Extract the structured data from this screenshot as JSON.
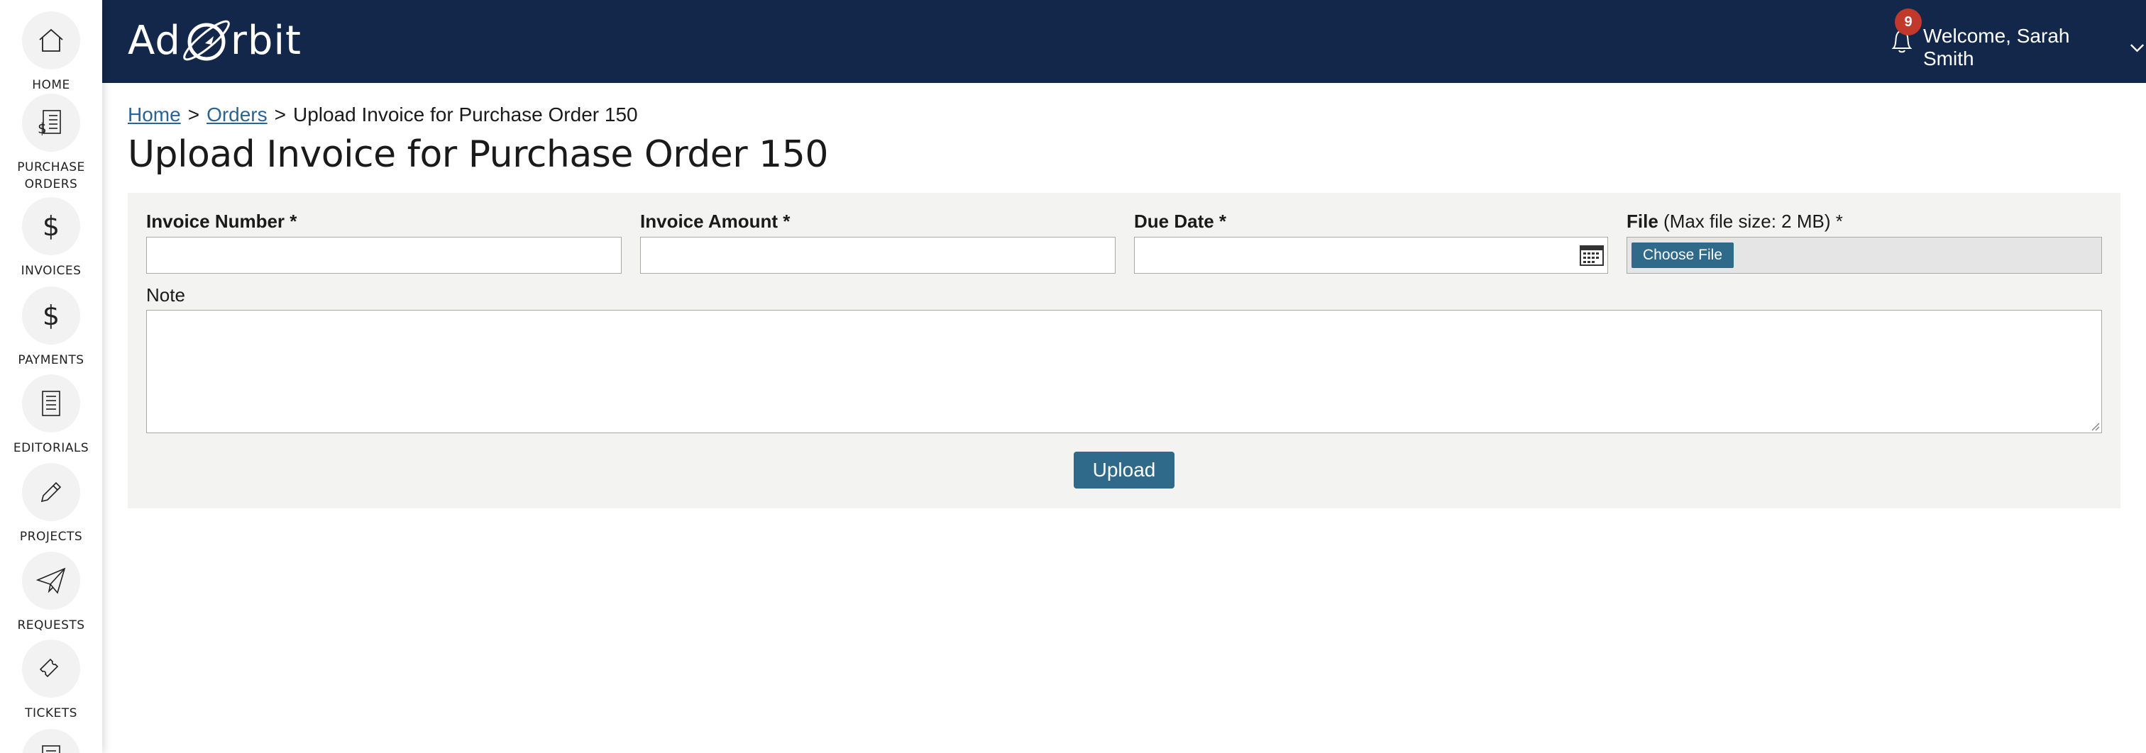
{
  "sidebar": {
    "items": [
      {
        "label": "HOME",
        "icon": "house-icon"
      },
      {
        "label": "PURCHASE\nORDERS",
        "icon": "purchase-orders-icon"
      },
      {
        "label": "INVOICES",
        "icon": "dollar-icon"
      },
      {
        "label": "PAYMENTS",
        "icon": "dollar-icon"
      },
      {
        "label": "EDITORIALS",
        "icon": "document-icon"
      },
      {
        "label": "PROJECTS",
        "icon": "pencil-icon"
      },
      {
        "label": "REQUESTS",
        "icon": "paper-plane-icon"
      },
      {
        "label": "TICKETS",
        "icon": "ticket-icon"
      },
      {
        "label": "",
        "icon": "document-icon"
      }
    ]
  },
  "header": {
    "logo_left": "Ad",
    "logo_right": "rbit",
    "notification_count": "9",
    "welcome": "Welcome, Sarah Smith",
    "background_color": "#13274a"
  },
  "breadcrumb": {
    "home": "Home",
    "separator": ">",
    "orders": "Orders",
    "current": "Upload Invoice for Purchase Order 150"
  },
  "page": {
    "title": "Upload Invoice for Purchase Order 150"
  },
  "form": {
    "invoice_number_label": "Invoice Number *",
    "invoice_number_value": "",
    "invoice_amount_label": "Invoice Amount *",
    "invoice_amount_value": "",
    "due_date_label": "Due Date *",
    "due_date_value": "",
    "file_label": "File",
    "file_hint": "(Max file size: 2 MB) *",
    "choose_file_label": "Choose File",
    "note_label": "Note",
    "note_value": "",
    "upload_label": "Upload",
    "accent_color": "#2f6a8a"
  }
}
